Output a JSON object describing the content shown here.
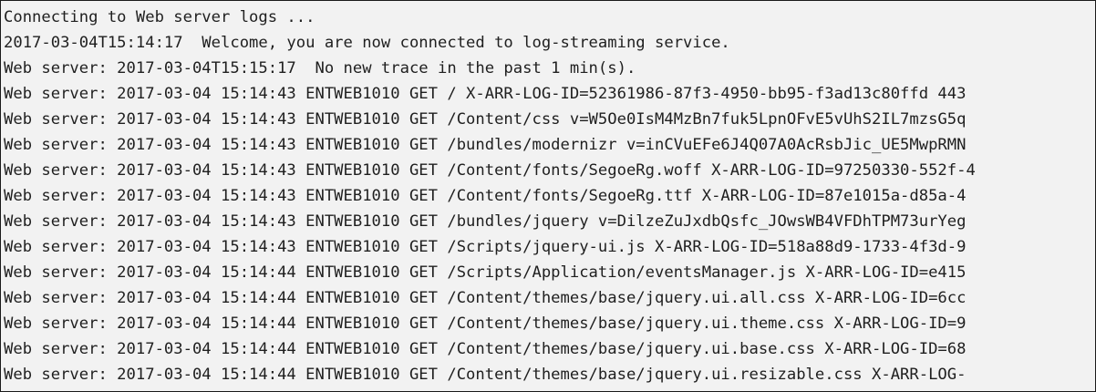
{
  "console": {
    "lines": [
      "Connecting to Web server logs ...",
      "2017-03-04T15:14:17  Welcome, you are now connected to log-streaming service.",
      "Web server: 2017-03-04T15:15:17  No new trace in the past 1 min(s).",
      "Web server: 2017-03-04 15:14:43 ENTWEB1010 GET / X-ARR-LOG-ID=52361986-87f3-4950-bb95-f3ad13c80ffd 443",
      "Web server: 2017-03-04 15:14:43 ENTWEB1010 GET /Content/css v=W5Oe0IsM4MzBn7fuk5LpnOFvE5vUhS2IL7mzsG5q",
      "Web server: 2017-03-04 15:14:43 ENTWEB1010 GET /bundles/modernizr v=inCVuEFe6J4Q07A0AcRsbJic_UE5MwpRMN",
      "Web server: 2017-03-04 15:14:43 ENTWEB1010 GET /Content/fonts/SegoeRg.woff X-ARR-LOG-ID=97250330-552f-4",
      "Web server: 2017-03-04 15:14:43 ENTWEB1010 GET /Content/fonts/SegoeRg.ttf X-ARR-LOG-ID=87e1015a-d85a-4",
      "Web server: 2017-03-04 15:14:43 ENTWEB1010 GET /bundles/jquery v=DilzeZuJxdbQsfc_JOwsWB4VFDhTPM73urYeg",
      "Web server: 2017-03-04 15:14:43 ENTWEB1010 GET /Scripts/jquery-ui.js X-ARR-LOG-ID=518a88d9-1733-4f3d-9",
      "Web server: 2017-03-04 15:14:44 ENTWEB1010 GET /Scripts/Application/eventsManager.js X-ARR-LOG-ID=e415",
      "Web server: 2017-03-04 15:14:44 ENTWEB1010 GET /Content/themes/base/jquery.ui.all.css X-ARR-LOG-ID=6cc",
      "Web server: 2017-03-04 15:14:44 ENTWEB1010 GET /Content/themes/base/jquery.ui.theme.css X-ARR-LOG-ID=9",
      "Web server: 2017-03-04 15:14:44 ENTWEB1010 GET /Content/themes/base/jquery.ui.base.css X-ARR-LOG-ID=68",
      "Web server: 2017-03-04 15:14:44 ENTWEB1010 GET /Content/themes/base/jquery.ui.resizable.css X-ARR-LOG-"
    ]
  }
}
